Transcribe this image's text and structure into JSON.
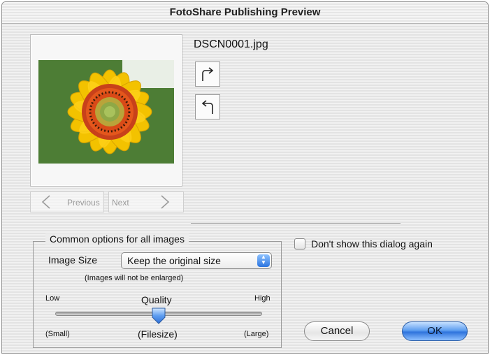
{
  "window": {
    "title": "FotoShare Publishing Preview"
  },
  "preview": {
    "filename": "DSCN0001.jpg",
    "rotate_right_icon": "rotate-clockwise-icon",
    "rotate_left_icon": "rotate-counterclockwise-icon"
  },
  "navigation": {
    "previous_label": "Previous",
    "next_label": "Next"
  },
  "options": {
    "group_title": "Common options for all images",
    "image_size_label": "Image Size",
    "image_size_value": "Keep the original size",
    "image_size_note": "(Images will not be enlarged)",
    "quality_label": "Quality",
    "quality_low": "Low",
    "quality_high": "High",
    "size_small": "(Small)",
    "size_filesize": "(Filesize)",
    "size_large": "(Large)",
    "quality_level": 0.5
  },
  "dont_show_again": {
    "label": "Don't show this dialog again",
    "checked": false
  },
  "buttons": {
    "cancel": "Cancel",
    "ok": "OK"
  },
  "colors": {
    "accent": "#2f74dd",
    "petal": "#f5c400",
    "flower_center": "#e4571c"
  }
}
